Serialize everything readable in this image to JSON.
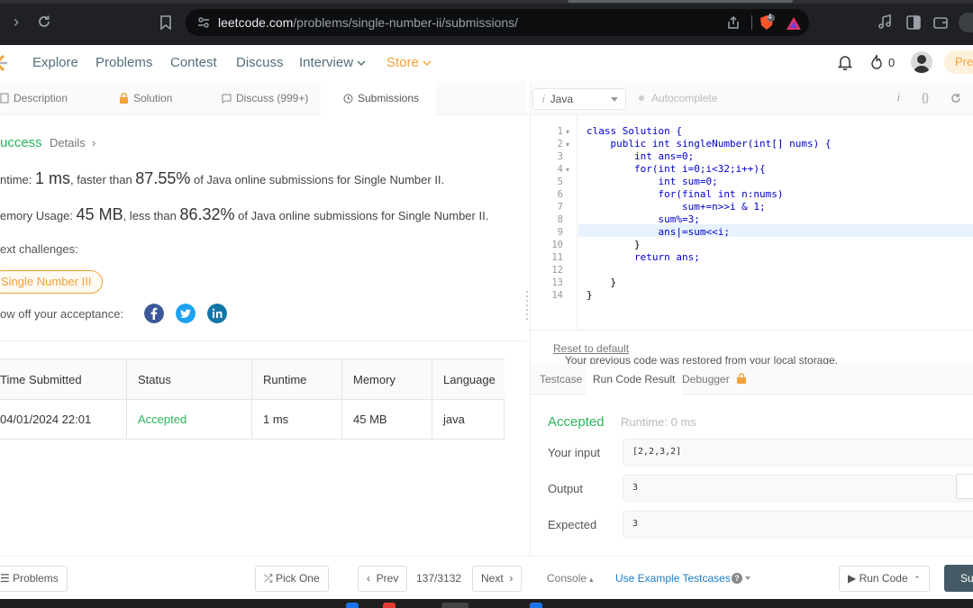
{
  "browser": {
    "url_host": "leetcode.com",
    "url_path": "/problems/single-number-ii/submissions/",
    "brave_badge": "4"
  },
  "header": {
    "nav": [
      "Explore",
      "Problems",
      "Contest",
      "Discuss",
      "Interview",
      "Store"
    ],
    "fire_count": "0",
    "premium_label": "Pre"
  },
  "left_tabs": [
    "Description",
    "Solution",
    "Discuss (999+)",
    "Submissions"
  ],
  "submission": {
    "status_text": "uccess",
    "details_label": "Details",
    "runtime_prefix": "ntime: ",
    "runtime_value": "1 ms",
    "runtime_mid": ", faster than ",
    "runtime_pct": "87.55%",
    "runtime_suffix": " of Java online submissions for Single Number II.",
    "memory_prefix": "emory Usage: ",
    "memory_value": "45 MB",
    "memory_mid": ", less than ",
    "memory_pct": "86.32%",
    "memory_suffix": " of Java online submissions for Single Number II.",
    "next_challenges_label": "ext challenges:",
    "next_challenge": "Single Number III",
    "showoff_label": "ow off your acceptance:"
  },
  "table": {
    "headers": [
      "Time Submitted",
      "Status",
      "Runtime",
      "Memory",
      "Language"
    ],
    "row": [
      "04/01/2024 22:01",
      "Accepted",
      "1 ms",
      "45 MB",
      "java"
    ]
  },
  "editor": {
    "language": "Java",
    "autocomplete_label": "Autocomplete",
    "lines": [
      "class Solution {",
      "    public int singleNumber(int[] nums) {",
      "        int ans=0;",
      "        for(int i=0;i<32;i++){",
      "            int sum=0;",
      "            for(final int n:nums)",
      "                sum+=n>>i & 1;",
      "            sum%=3;",
      "            ans|=sum<<i;",
      "        }",
      "        return ans;",
      "",
      "    }",
      "}"
    ],
    "line_numbers": [
      "1",
      "2",
      "3",
      "4",
      "5",
      "6",
      "7",
      "8",
      "9",
      "10",
      "11",
      "12",
      "13",
      "14"
    ]
  },
  "restore": {
    "message": "Your previous code was restored from your local storage.",
    "reset_link": "Reset to default"
  },
  "result_tabs": [
    "Testcase",
    "Run Code Result",
    "Debugger"
  ],
  "result": {
    "status": "Accepted",
    "runtime": "Runtime: 0 ms",
    "input_label": "Your input",
    "input_value": "[2,2,3,2]",
    "output_label": "Output",
    "output_value": "3",
    "expected_label": "Expected",
    "expected_value": "3"
  },
  "footer": {
    "problems_label": "Problems",
    "pick_one_label": "Pick One",
    "prev_label": "Prev",
    "count": "137/3132",
    "next_label": "Next",
    "console_label": "Console",
    "use_example_label": "Use Example Testcases",
    "run_code_label": "Run Code",
    "submit_label": "Su"
  },
  "colors": {
    "success_green": "#2db55d",
    "store_orange": "#f0a23b",
    "link_blue": "#1a7bcb"
  }
}
